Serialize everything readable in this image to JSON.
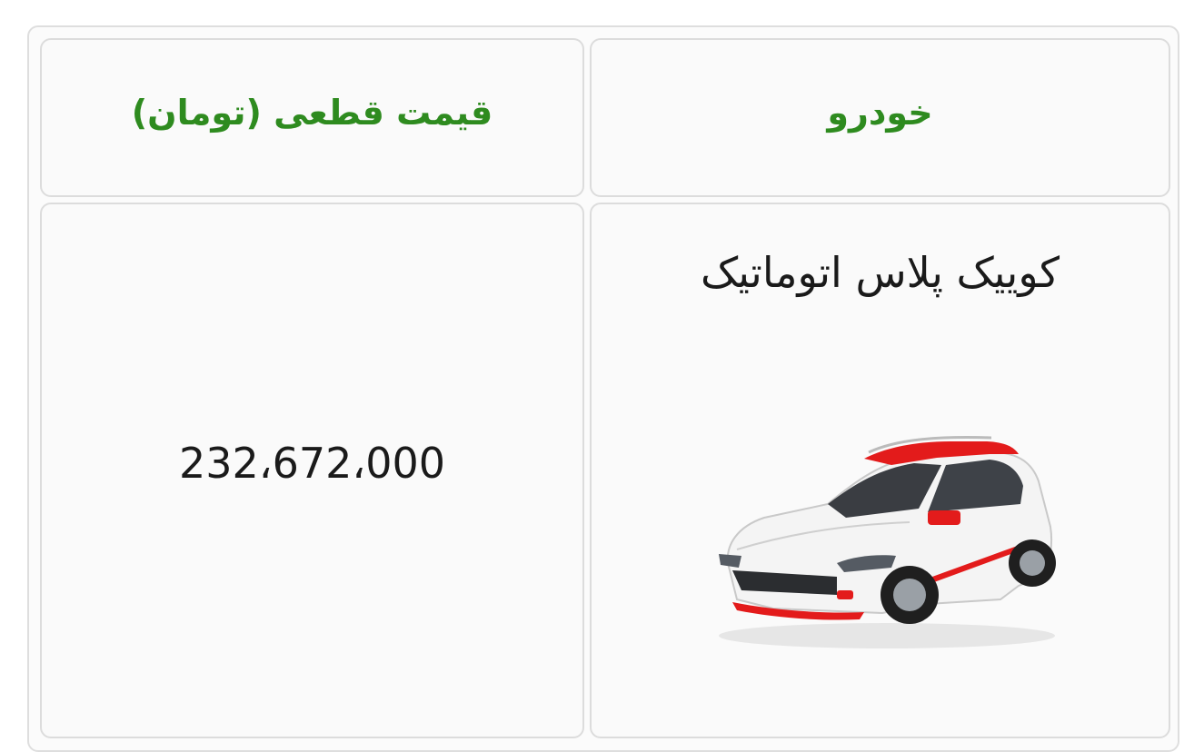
{
  "table": {
    "headers": {
      "car": "خودرو",
      "price": "قیمت قطعی (تومان)"
    },
    "rows": [
      {
        "car_name": "کوییک پلاس اتوماتیک",
        "car_image_icon": "car-image",
        "price": "232،672،000"
      }
    ]
  },
  "colors": {
    "header_text": "#2e8b1f",
    "body_text": "#1a1a1a",
    "border": "#dcdcdc",
    "cell_bg": "#fafafa",
    "car_body": "#f2f2f2",
    "car_accent": "#e31b1b"
  }
}
